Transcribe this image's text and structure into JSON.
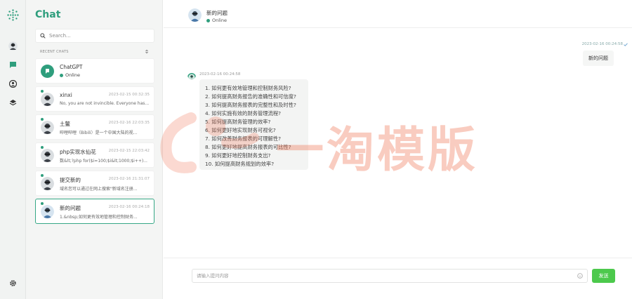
{
  "sidebar": {
    "title": "Chat",
    "search_placeholder": "Search...",
    "recent_label": "RECENT CHATS",
    "chats": [
      {
        "name": "ChatGPT",
        "status": "Online"
      },
      {
        "name": "xinxi",
        "time": "2023-02-15 00:32:35",
        "preview": "No, you are not invincible. Everyone has..."
      },
      {
        "name": "土鳖",
        "time": "2023-02-16 22:03:35",
        "preview": "哔哩哔哩（Bibili）是一个中国大陆的视..."
      },
      {
        "name": "php实现水仙花",
        "time": "2023-02-15 22:03:42",
        "preview": "数&lt;?php for($i=100;$i&lt;1000;$i++)..."
      },
      {
        "name": "提交新的",
        "time": "2023-02-16 21:31:07",
        "preview": "域名您可以通过在网上搜索\"新域名注册..."
      },
      {
        "name": "新的问题",
        "time": "2023-02-16 00:24:18",
        "preview": "1.&nbsp;如何更有效地管理和控制财务..."
      }
    ]
  },
  "header": {
    "title": "新的问题",
    "status": "Online"
  },
  "messages": {
    "outgoing": {
      "time": "2023-02-16 00:24:58",
      "text": "新的问题"
    },
    "incoming": {
      "time": "2023-02-16 00:24:58",
      "lines": [
        "1. 如何更有效地管理和控制财务风险?",
        "2. 如何提高财务报告的准确性和可信度?",
        "3. 如何提高财务报表的完整性和及时性?",
        "4. 如何实施有效的财务管理流程?",
        "5. 如何提高财务管理的效率?",
        "6. 如何更好地实现财务可视化?",
        "7. 如何改善财务报表的可理解性?",
        "8. 如何更好地提高财务报表的可比性?",
        "9. 如何更好地控制财务支出?",
        "10. 如何提高财务规划的效率?"
      ]
    }
  },
  "composer": {
    "placeholder": "请输入提问内容",
    "send_label": "发送"
  },
  "watermark": {
    "text": "一淘模版"
  },
  "colors": {
    "accent": "#2f9e7d",
    "send": "#4cc94c",
    "watermark": "#f0785a"
  }
}
